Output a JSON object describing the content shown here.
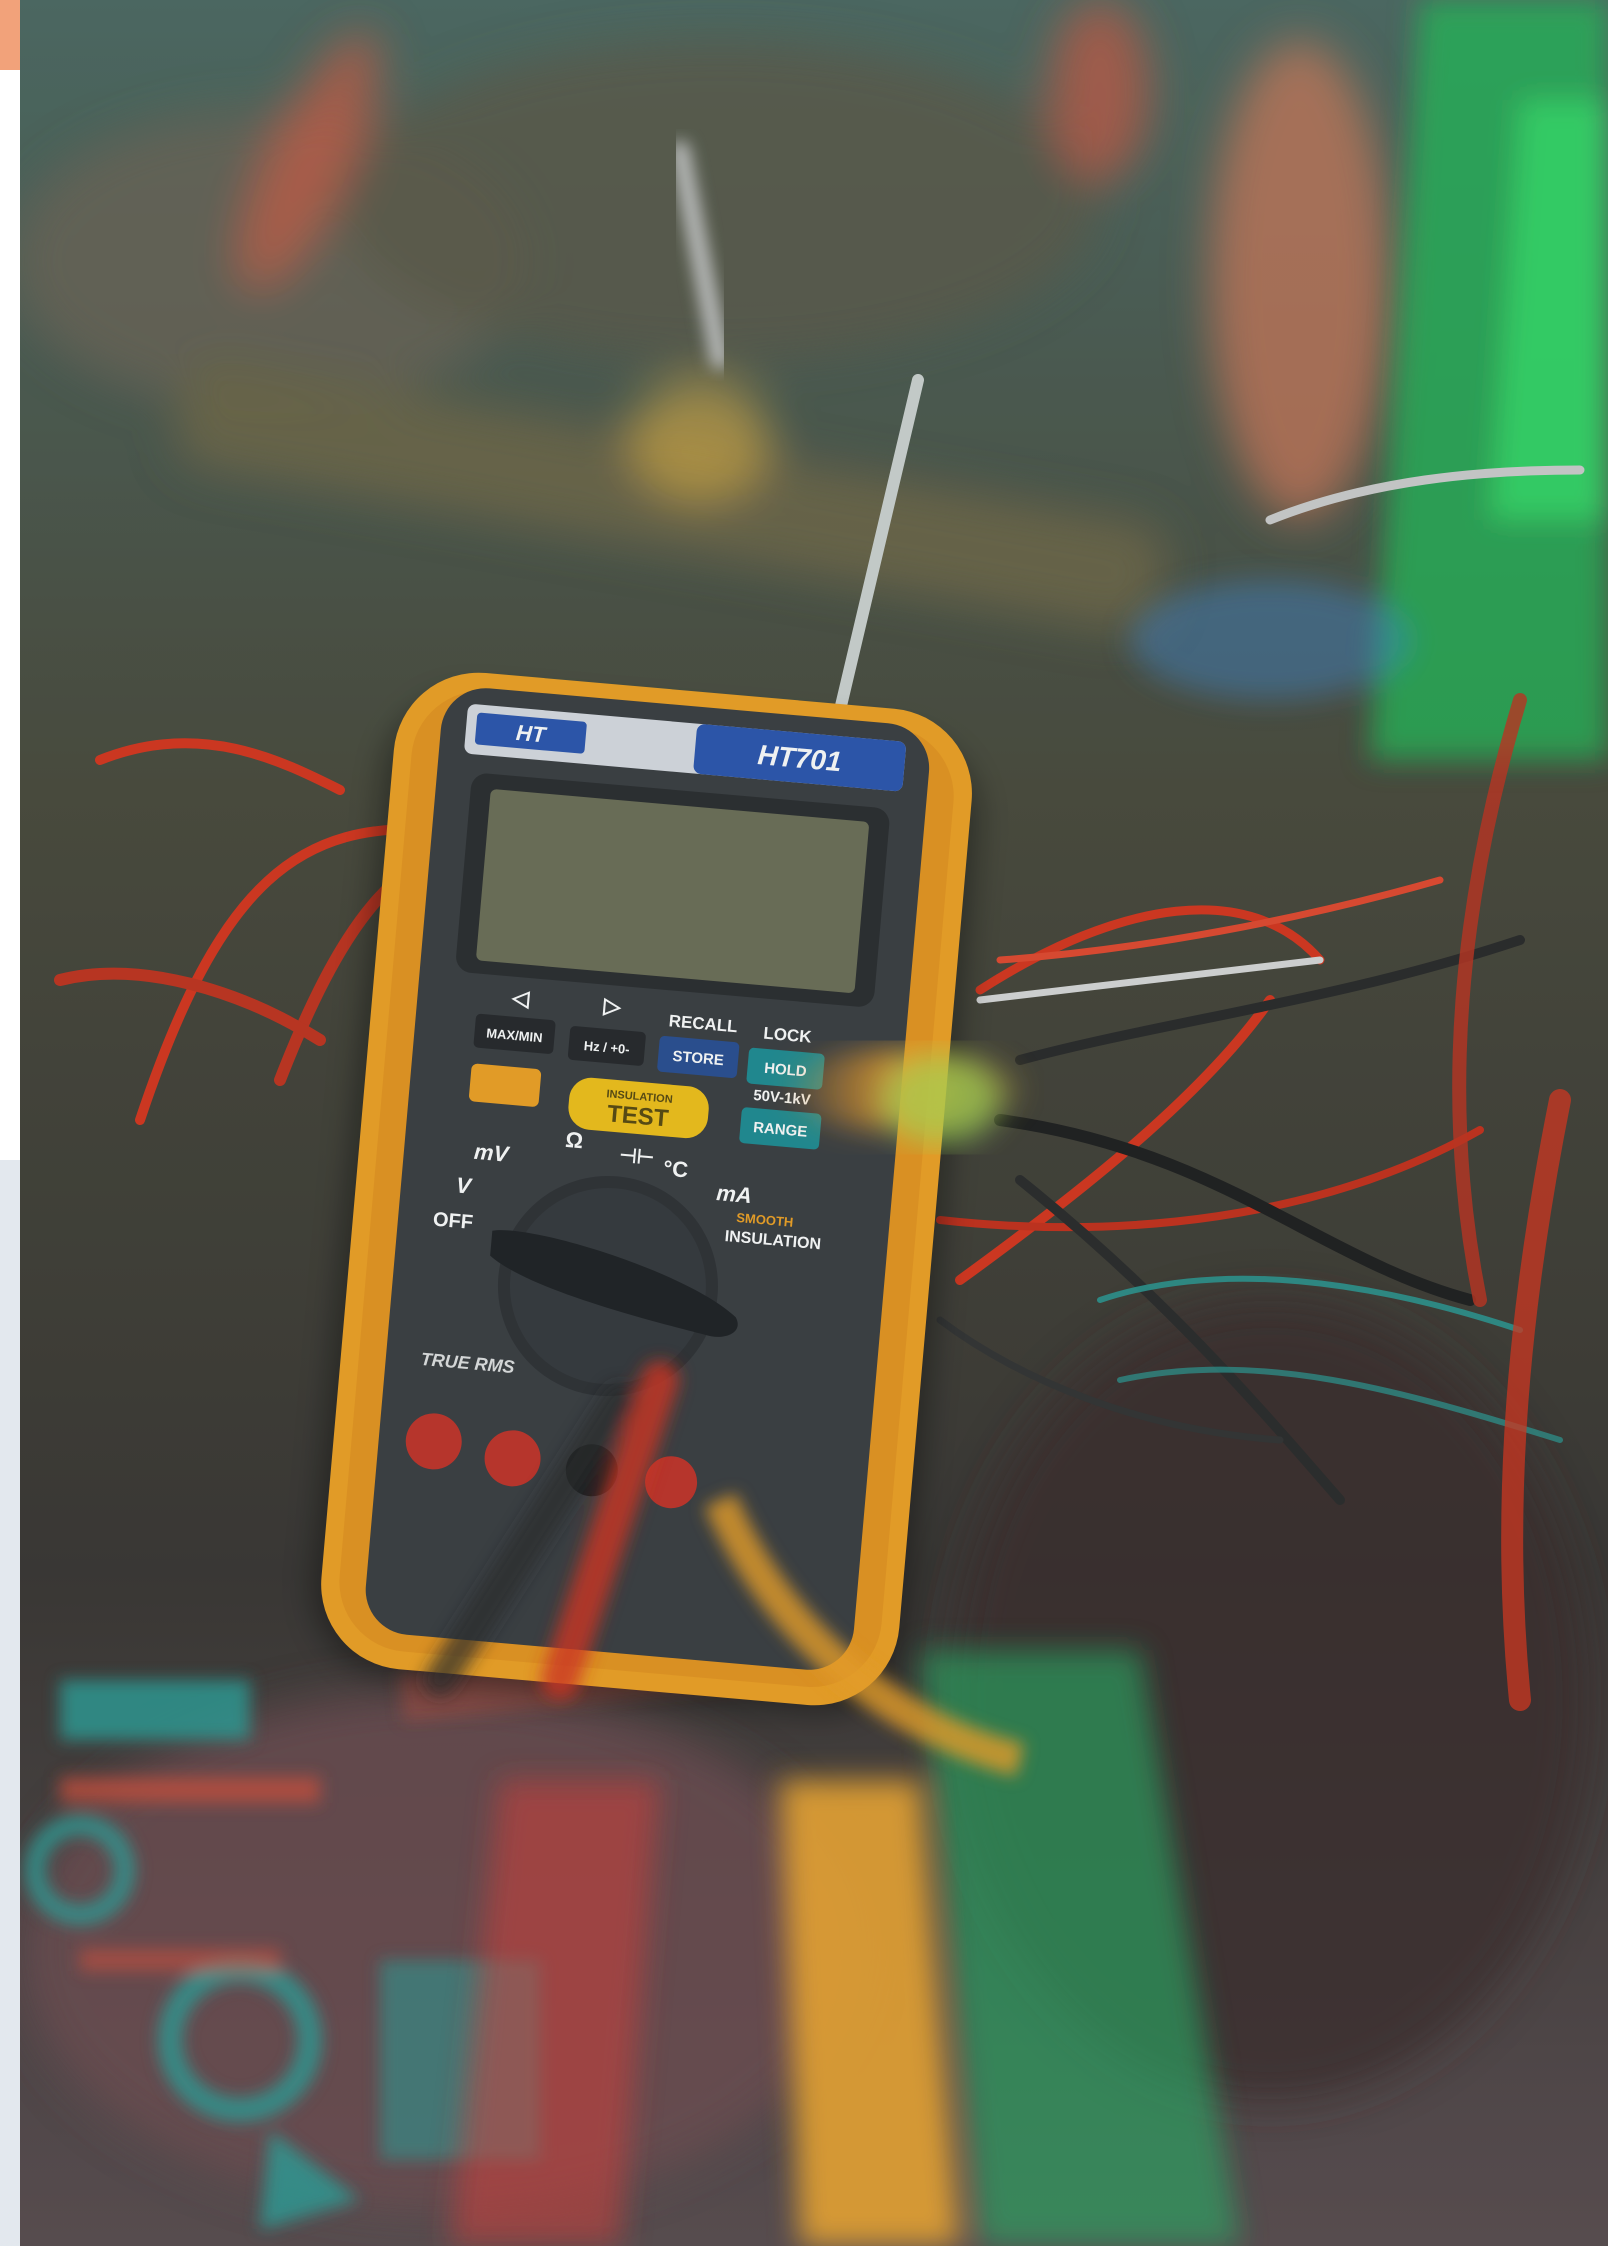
{
  "photo": {
    "meter": {
      "brand": "HT",
      "model": "HT701",
      "buttons": {
        "maxmin": "MAX/MIN",
        "hz": "Hz / +0-",
        "store": "STORE",
        "hold": "HOLD",
        "test_small": "INSULATION",
        "test": "TEST",
        "range": "RANGE"
      },
      "labels": {
        "recall": "RECALL",
        "lock": "LOCK",
        "voltage_range": "50V-1kV",
        "off": "OFF",
        "mv": "mV",
        "ohm": "Ω",
        "cap": "⊣⊢",
        "temp": "°C",
        "ma": "mA",
        "v": "V",
        "smooth": "SMOOTH",
        "insulation": "INSULATION",
        "true_rms": "TRUE RMS"
      }
    },
    "colors": {
      "meter_body": "#f0a224",
      "panel": "#3b3e42",
      "lcd": "#6d6f57",
      "brand_band": "#2c56b0",
      "test_button": "#f2c21a",
      "teal_button": "#1f8d94",
      "wire_red": "#d8361e",
      "bench_teal": "#2aa39b"
    }
  }
}
